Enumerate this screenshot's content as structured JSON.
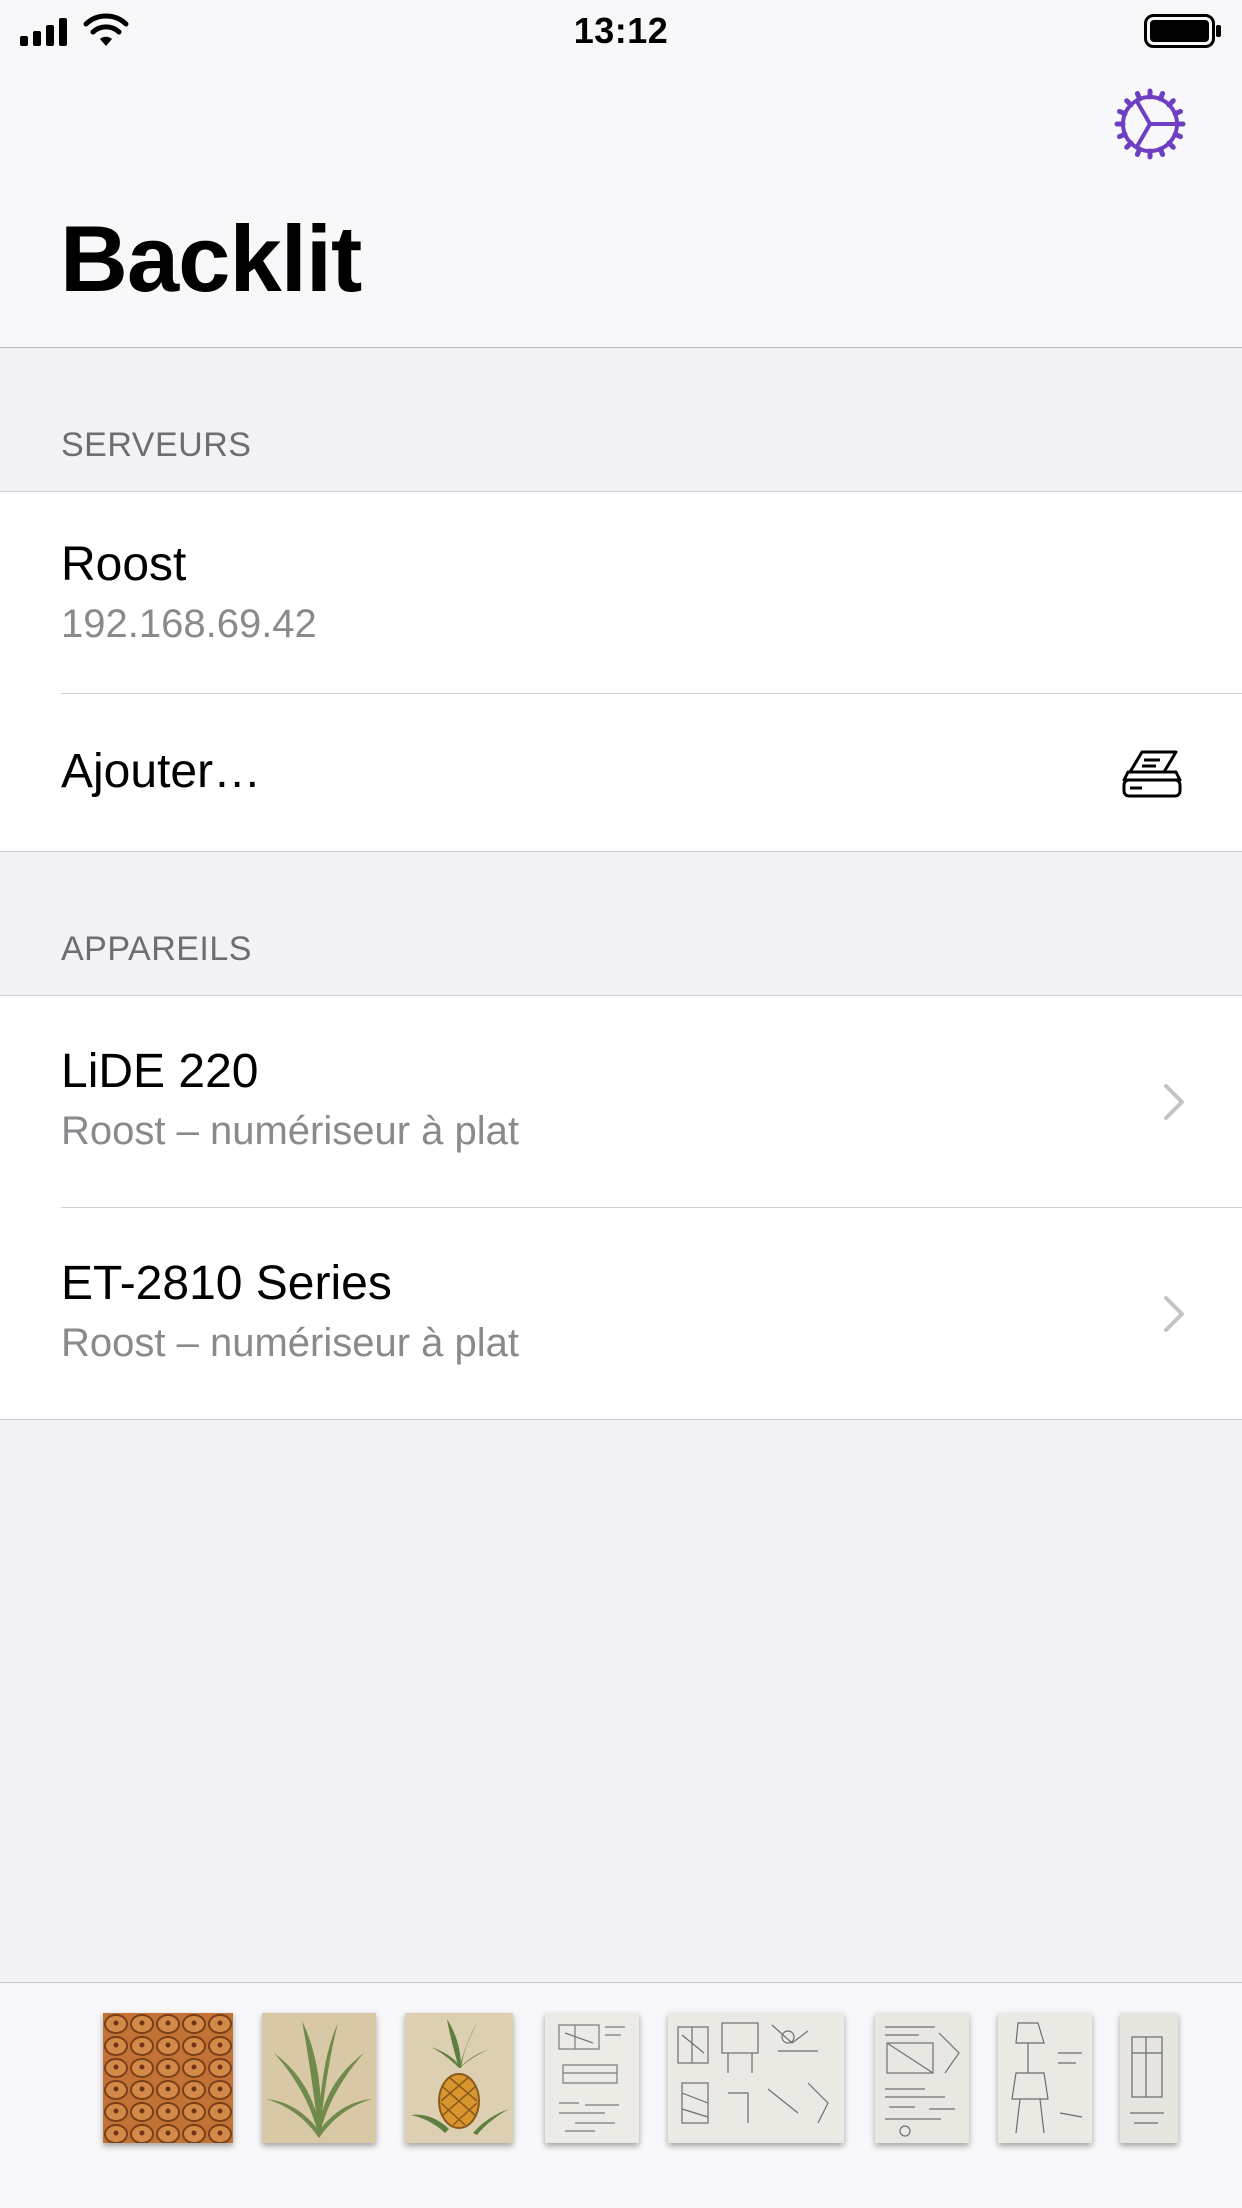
{
  "status_bar": {
    "time": "13:12"
  },
  "header": {
    "title": "Backlit",
    "settings_icon": "gear-icon",
    "accent_color": "#6e3fc2"
  },
  "sections": {
    "servers": {
      "label": "SERVEURS",
      "items": [
        {
          "title": "Roost",
          "subtitle": "192.168.69.42"
        },
        {
          "title": "Ajouter…",
          "icon": "scanner-icon"
        }
      ]
    },
    "devices": {
      "label": "APPAREILS",
      "items": [
        {
          "title": "LiDE 220",
          "subtitle": "Roost – numériseur à plat",
          "icon": "chevron-right-icon"
        },
        {
          "title": "ET-2810 Series",
          "subtitle": "Roost – numériseur à plat",
          "icon": "chevron-right-icon"
        }
      ]
    }
  },
  "thumbnails": [
    {
      "kind": "pineapple-skin",
      "color": "#b5652c"
    },
    {
      "kind": "pineapple-plant",
      "color": "#d8c8a6"
    },
    {
      "kind": "pineapple-fruit",
      "color": "#ddd0b2"
    },
    {
      "kind": "sketch",
      "color": "#ecebe5"
    },
    {
      "kind": "sketch",
      "color": "#eae9e3"
    },
    {
      "kind": "sketch",
      "color": "#e8e7e1"
    },
    {
      "kind": "sketch",
      "color": "#eae9e3"
    },
    {
      "kind": "sketch",
      "color": "#e6e5df"
    }
  ]
}
